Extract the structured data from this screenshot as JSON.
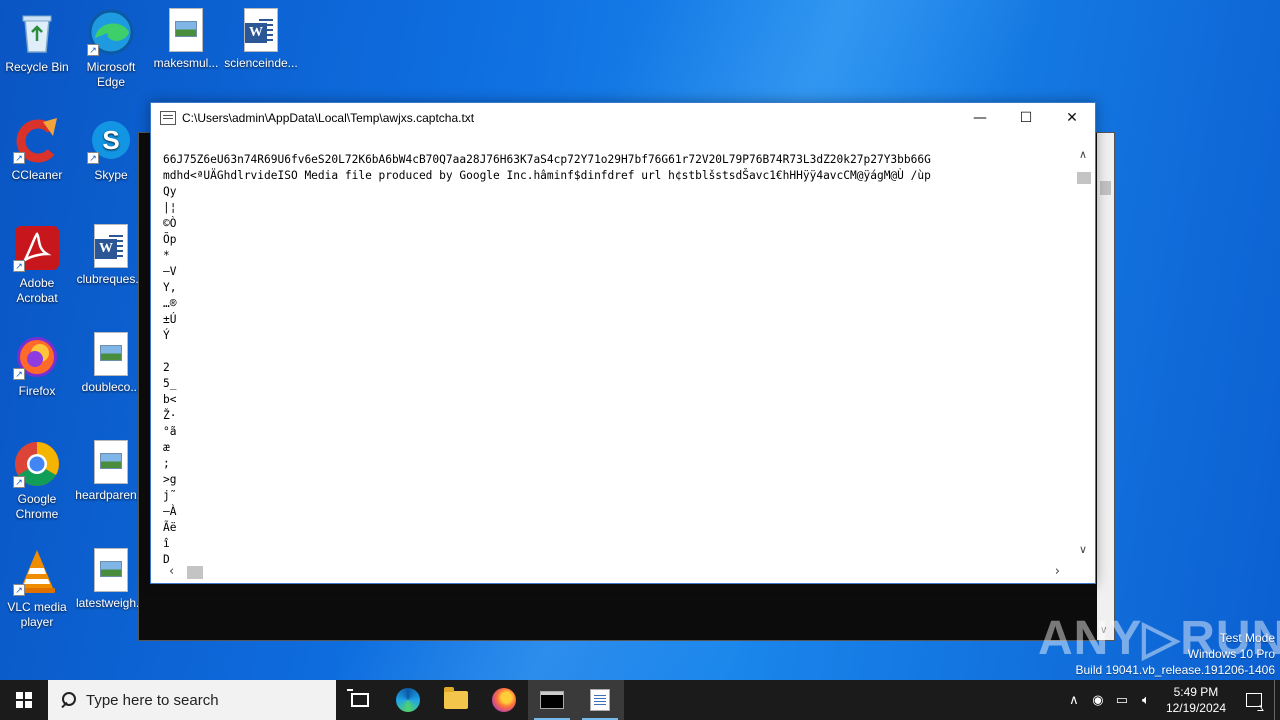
{
  "desktop": {
    "icons": [
      {
        "label": "Recycle Bin",
        "icon": "recycle-bin-icon"
      },
      {
        "label": "Microsoft Edge",
        "icon": "edge-icon"
      },
      {
        "label": "makesmul...",
        "icon": "image-file-icon"
      },
      {
        "label": "scienceinde...",
        "icon": "word-document-icon"
      },
      {
        "label": "CCleaner",
        "icon": "ccleaner-icon"
      },
      {
        "label": "Skype",
        "icon": "skype-icon"
      },
      {
        "label": "Adobe Acrobat",
        "icon": "acrobat-icon"
      },
      {
        "label": "clubreques...",
        "icon": "word-document-icon"
      },
      {
        "label": "Firefox",
        "icon": "firefox-icon"
      },
      {
        "label": "doubleco...",
        "icon": "image-file-icon"
      },
      {
        "label": "Google Chrome",
        "icon": "chrome-icon"
      },
      {
        "label": "heardparen...",
        "icon": "image-file-icon"
      },
      {
        "label": "VLC media player",
        "icon": "vlc-icon"
      },
      {
        "label": "latestweigh...",
        "icon": "image-file-icon"
      }
    ]
  },
  "notepad": {
    "title": "C:\\Users\\admin\\AppData\\Local\\Temp\\awjxs.captcha.txt",
    "minimize": "—",
    "maximize": "☐",
    "close": "✕",
    "content": "66J75Z6eU63n74R69U6fv6eS20L72K6bA6bW4cB70Q7aa28J76H63K7aS4cp72Y71o29H7bf76G61r72V20L79P76B74R73L3dZ20k27p27Y3bb66G\nmdhd<ªUÄGhdlrvideISO Media file produced by Google Inc.hâminf$dinfdref url h¢stblšstsdŠavc1€hHHÿÿ4avcCM@ÿágM@Ù /ùp\nQy\n|¦\n©Ò\nÕp\n*\n–V\nY,\n…®\n±Ú\nÝ\n\n2\n5_\nb<\nŽ·\n°ã\næ\n;\n>g\nj˜\n–À\nÃë\nî\nD"
  },
  "watermark": {
    "brand": "ANY▷RUN",
    "line1": "Test Mode",
    "line2": "Windows 10 Pro",
    "line3": "Build 19041.vb_release.191206-1406"
  },
  "taskbar": {
    "search_placeholder": "Type here to search",
    "time": "5:49 PM",
    "date": "12/19/2024"
  }
}
